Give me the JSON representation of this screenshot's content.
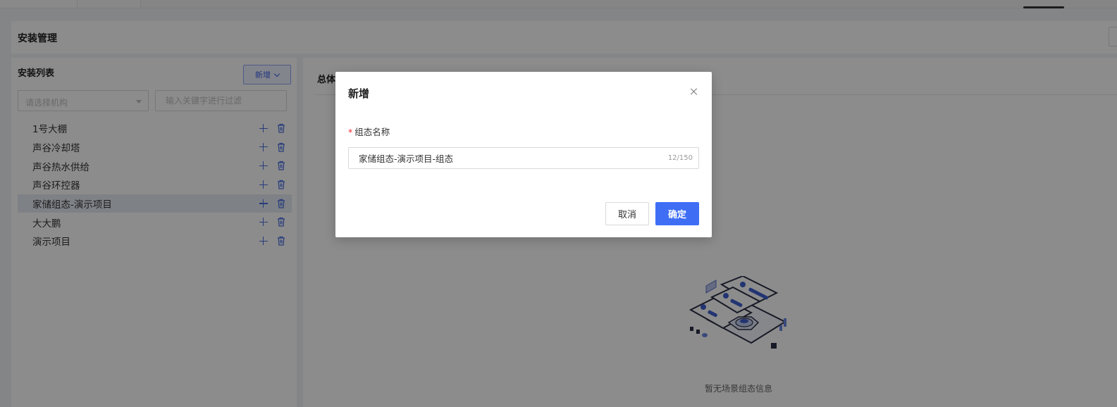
{
  "page": {
    "title": "安装管理"
  },
  "sidebar": {
    "title": "安装列表",
    "add_label": "新增",
    "org_select_placeholder": "请选择机构",
    "filter_placeholder": "输入关键字进行过滤",
    "items": [
      {
        "label": "1号大棚"
      },
      {
        "label": "声谷冷却塔"
      },
      {
        "label": "声谷热水供给"
      },
      {
        "label": "声谷环控器"
      },
      {
        "label": "家储组态-演示项目",
        "selected": true
      },
      {
        "label": "大大鹏"
      },
      {
        "label": "演示项目"
      }
    ]
  },
  "main": {
    "tab_label": "总体",
    "empty_text": "暂无场景组态信息"
  },
  "modal": {
    "title": "新增",
    "field_label": "组态名称",
    "required_mark": "*",
    "name_value": "家储组态-演示项目-组态",
    "counter": "12/150",
    "cancel_label": "取消",
    "ok_label": "确定"
  },
  "colors": {
    "primary": "#3f6ef5",
    "selected_row": "#e6ebf5",
    "required": "#f5222d"
  }
}
